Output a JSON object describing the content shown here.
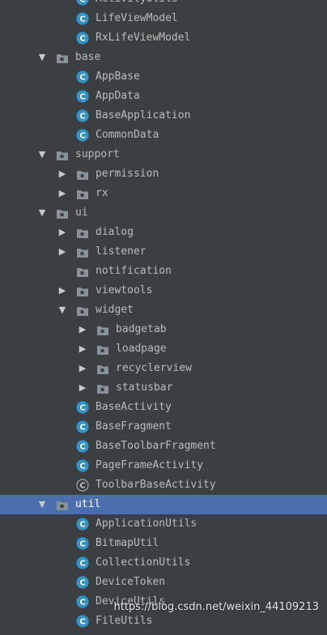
{
  "tree": [
    {
      "label": "ActivityUtils",
      "type": "class",
      "depth": 2
    },
    {
      "label": "LifeViewModel",
      "type": "class",
      "depth": 2
    },
    {
      "label": "RxLifeViewModel",
      "type": "class",
      "depth": 2
    },
    {
      "label": "base",
      "type": "folder",
      "depth": 1,
      "expanded": true
    },
    {
      "label": "AppBase",
      "type": "class",
      "depth": 2
    },
    {
      "label": "AppData",
      "type": "class",
      "depth": 2
    },
    {
      "label": "BaseApplication",
      "type": "class",
      "depth": 2
    },
    {
      "label": "CommonData",
      "type": "class",
      "depth": 2
    },
    {
      "label": "support",
      "type": "folder",
      "depth": 1,
      "expanded": true
    },
    {
      "label": "permission",
      "type": "folder",
      "depth": 2,
      "expanded": false
    },
    {
      "label": "rx",
      "type": "folder",
      "depth": 2,
      "expanded": false
    },
    {
      "label": "ui",
      "type": "folder",
      "depth": 1,
      "expanded": true
    },
    {
      "label": "dialog",
      "type": "folder",
      "depth": 2,
      "expanded": false
    },
    {
      "label": "listener",
      "type": "folder",
      "depth": 2,
      "expanded": false
    },
    {
      "label": "notification",
      "type": "folder",
      "depth": 2,
      "expanded": null
    },
    {
      "label": "viewtools",
      "type": "folder",
      "depth": 2,
      "expanded": false
    },
    {
      "label": "widget",
      "type": "folder",
      "depth": 2,
      "expanded": true
    },
    {
      "label": "badgetab",
      "type": "folder",
      "depth": 3,
      "expanded": false
    },
    {
      "label": "loadpage",
      "type": "folder",
      "depth": 3,
      "expanded": false
    },
    {
      "label": "recyclerview",
      "type": "folder",
      "depth": 3,
      "expanded": false
    },
    {
      "label": "statusbar",
      "type": "folder",
      "depth": 3,
      "expanded": false
    },
    {
      "label": "BaseActivity",
      "type": "class",
      "depth": 2
    },
    {
      "label": "BaseFragment",
      "type": "class",
      "depth": 2
    },
    {
      "label": "BaseToolbarFragment",
      "type": "class",
      "depth": 2
    },
    {
      "label": "PageFrameActivity",
      "type": "class",
      "depth": 2
    },
    {
      "label": "ToolbarBaseActivity",
      "type": "abstract-class",
      "depth": 2
    },
    {
      "label": "util",
      "type": "folder",
      "depth": 1,
      "expanded": true,
      "selected": true
    },
    {
      "label": "ApplicationUtils",
      "type": "class",
      "depth": 2
    },
    {
      "label": "BitmapUtil",
      "type": "class",
      "depth": 2
    },
    {
      "label": "CollectionUtils",
      "type": "class",
      "depth": 2
    },
    {
      "label": "DeviceToken",
      "type": "class",
      "depth": 2
    },
    {
      "label": "DeviceUtils",
      "type": "class",
      "depth": 2
    },
    {
      "label": "FileUtils",
      "type": "class",
      "depth": 2
    }
  ],
  "icons": {
    "class": "class-icon",
    "abstract-class": "abstract-class-icon",
    "folder": "package-folder-icon",
    "expanded": "chevron-down-icon",
    "collapsed": "chevron-right-icon"
  },
  "colors": {
    "background": "#3c3f41",
    "selection": "#4b6eaf",
    "class_icon": "#3592c4",
    "folder_icon": "#87939a"
  },
  "watermark": "https://blog.csdn.net/weixin_44109213"
}
